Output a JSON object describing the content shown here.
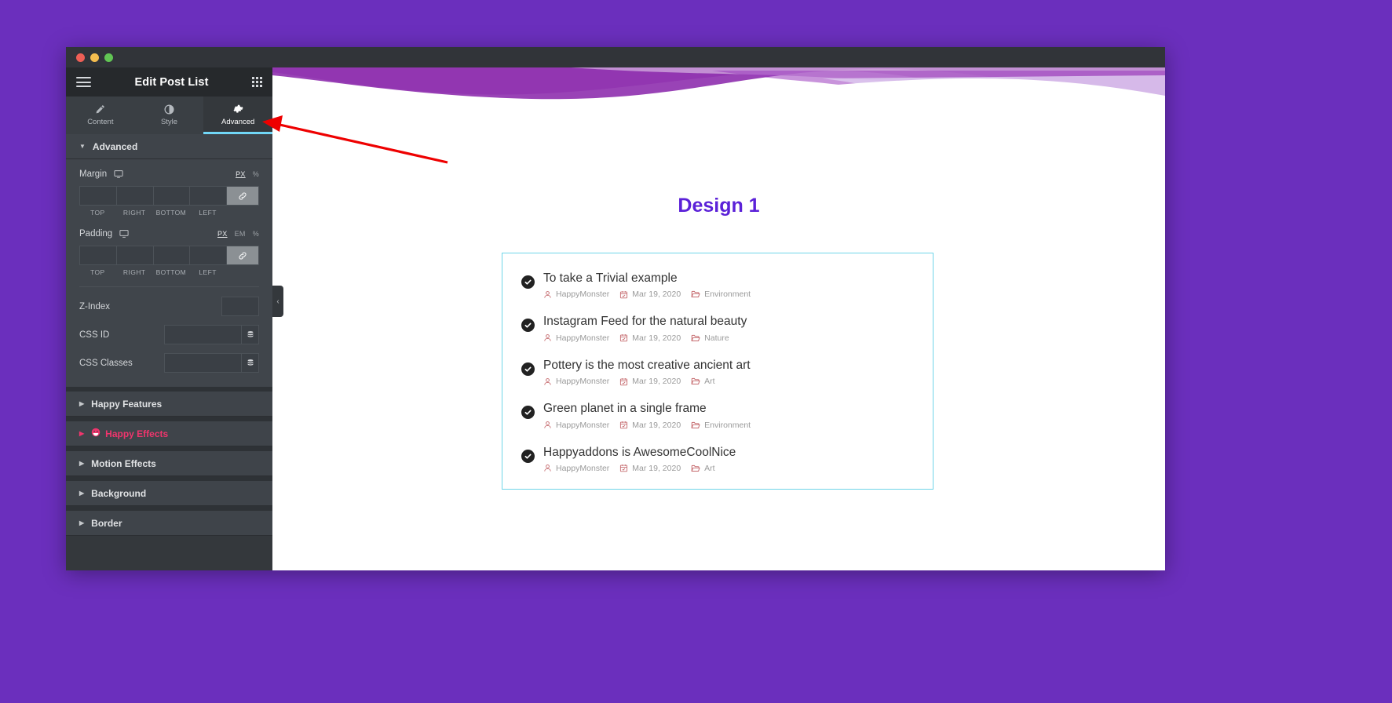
{
  "window": {
    "traffic_lights": [
      "close",
      "minimize",
      "maximize"
    ]
  },
  "panel": {
    "title": "Edit Post List",
    "menu_icon": "hamburger-icon",
    "grid_icon": "grid-icon",
    "collapse_icon": "‹",
    "tabs": [
      {
        "label": "Content",
        "icon": "pencil-icon",
        "active": false
      },
      {
        "label": "Style",
        "icon": "contrast-icon",
        "active": false
      },
      {
        "label": "Advanced",
        "icon": "gear-icon",
        "active": true
      }
    ],
    "advanced_section": {
      "title": "Advanced",
      "caret": "▼",
      "margin": {
        "label": "Margin",
        "device_icon": "desktop-icon",
        "units": [
          {
            "label": "PX",
            "active": true
          },
          {
            "label": "%",
            "active": false
          }
        ],
        "values": [
          "",
          "",
          "",
          ""
        ],
        "side_labels": [
          "TOP",
          "RIGHT",
          "BOTTOM",
          "LEFT"
        ],
        "link_icon": "link-icon"
      },
      "padding": {
        "label": "Padding",
        "device_icon": "desktop-icon",
        "units": [
          {
            "label": "PX",
            "active": true
          },
          {
            "label": "EM",
            "active": false
          },
          {
            "label": "%",
            "active": false
          }
        ],
        "values": [
          "",
          "",
          "",
          ""
        ],
        "side_labels": [
          "TOP",
          "RIGHT",
          "BOTTOM",
          "LEFT"
        ],
        "link_icon": "link-icon"
      },
      "z_index": {
        "label": "Z-Index",
        "value": ""
      },
      "css_id": {
        "label": "CSS ID",
        "value": "",
        "dynamic_icon": "database-icon"
      },
      "css_classes": {
        "label": "CSS Classes",
        "value": "",
        "dynamic_icon": "database-icon"
      }
    },
    "accordions": [
      {
        "label": "Happy Features",
        "caret": "▶",
        "icon": null,
        "accent": false
      },
      {
        "label": "Happy Effects",
        "caret": "▶",
        "icon": "happy-face-icon",
        "accent": true
      },
      {
        "label": "Motion Effects",
        "caret": "▶",
        "icon": null,
        "accent": false
      },
      {
        "label": "Background",
        "caret": "▶",
        "icon": null,
        "accent": false
      },
      {
        "label": "Border",
        "caret": "▶",
        "icon": null,
        "accent": false
      }
    ]
  },
  "preview": {
    "design_title": "Design 1",
    "posts": [
      {
        "title": "To take a Trivial example",
        "author": "HappyMonster",
        "date": "Mar 19, 2020",
        "category": "Environment"
      },
      {
        "title": "Instagram Feed for the natural beauty",
        "author": "HappyMonster",
        "date": "Mar 19, 2020",
        "category": "Nature"
      },
      {
        "title": "Pottery is the most creative ancient art",
        "author": "HappyMonster",
        "date": "Mar 19, 2020",
        "category": "Art"
      },
      {
        "title": "Green planet in a single frame",
        "author": "HappyMonster",
        "date": "Mar 19, 2020",
        "category": "Environment"
      },
      {
        "title": "Happyaddons is AwesomeCoolNice",
        "author": "HappyMonster",
        "date": "Mar 19, 2020",
        "category": "Art"
      }
    ],
    "meta_icons": {
      "author": "user-icon",
      "date": "calendar-icon",
      "category": "folder-icon"
    },
    "bullet_icon": "check-circle-icon"
  },
  "colors": {
    "page_background": "#6b2fbd",
    "panel_background": "#34383c",
    "panel_header": "#26292c",
    "tab_active_underline": "#71d7f7",
    "accent_pink": "#f0356d",
    "design_title": "#5b21d8",
    "widget_outline": "#6fd5e8",
    "meta_icon": "#c56a6e",
    "annotation_arrow": "#ee0000"
  },
  "annotation": {
    "type": "arrow",
    "points_to": "Advanced tab"
  }
}
